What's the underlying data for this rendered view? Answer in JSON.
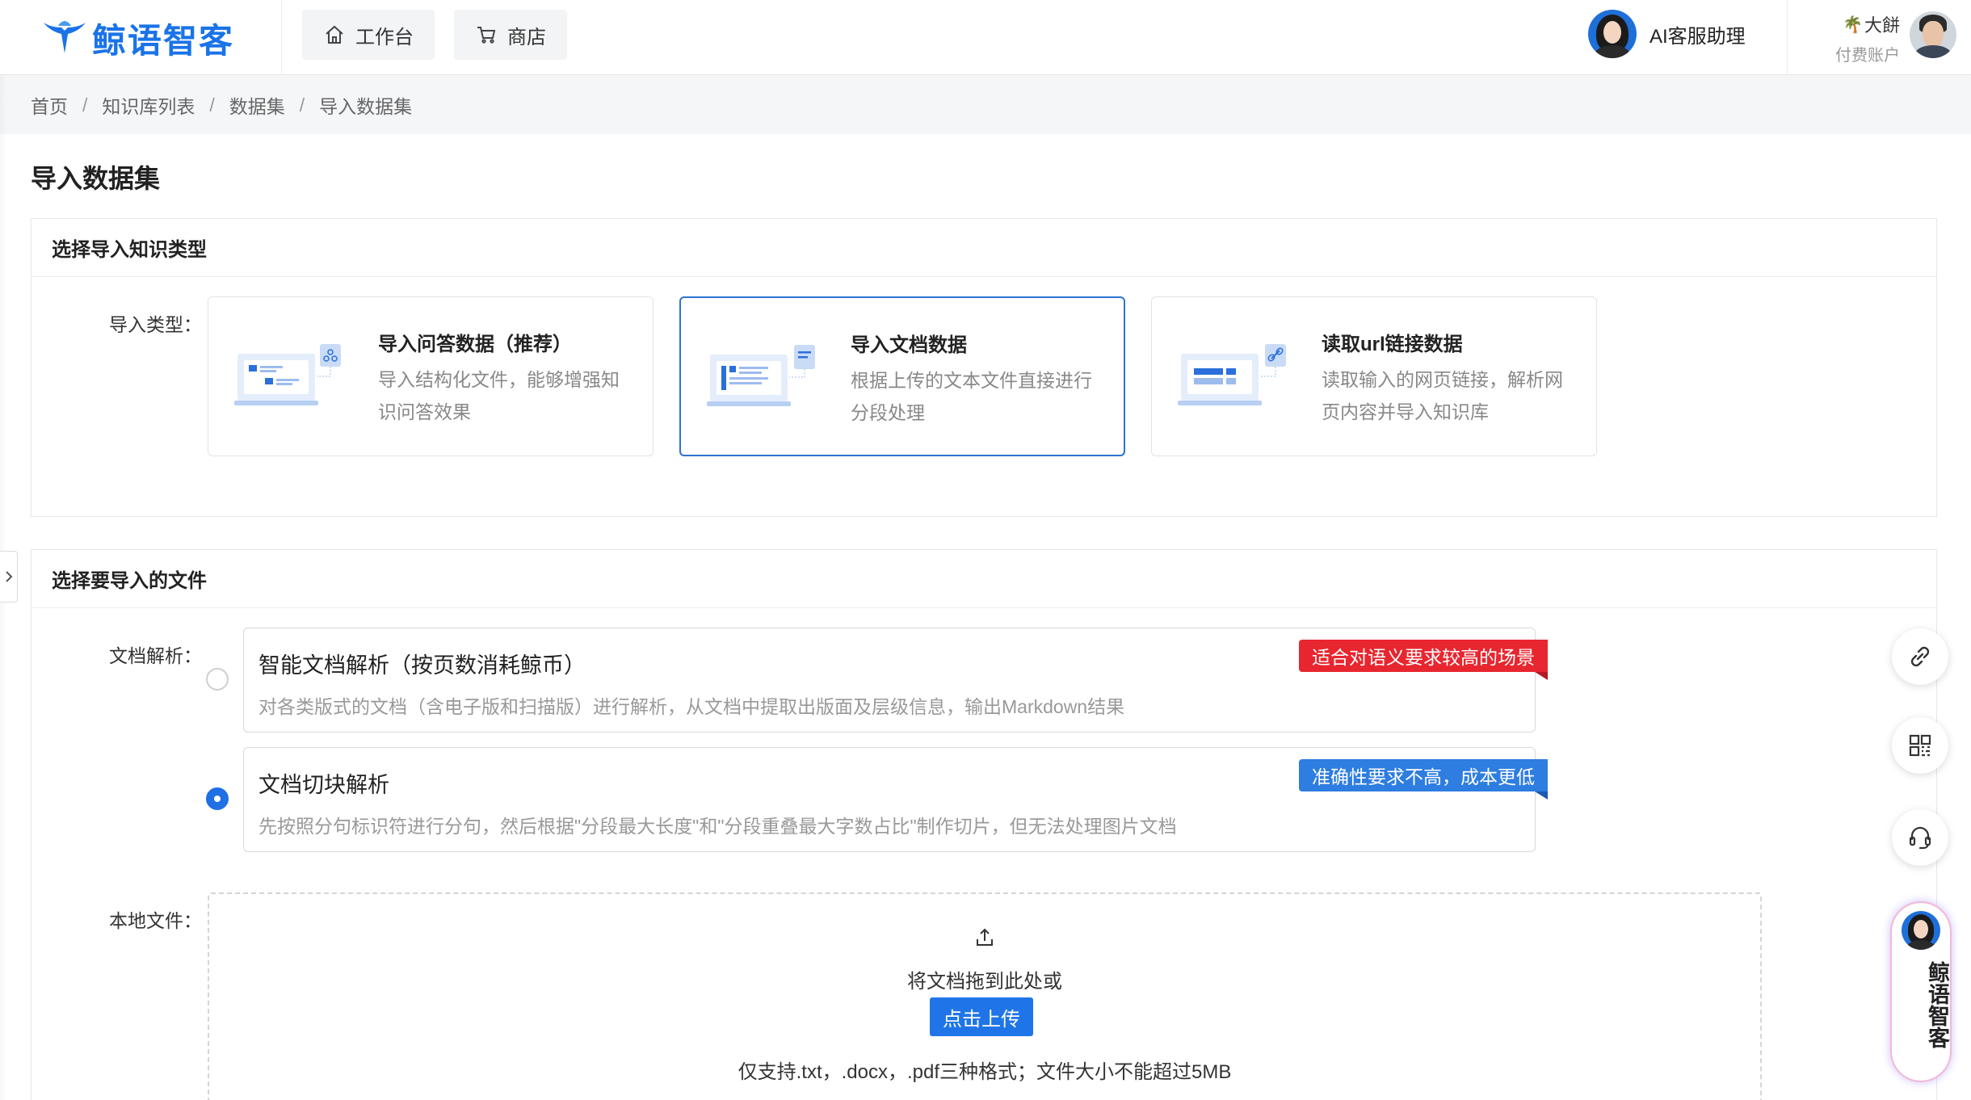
{
  "app": {
    "logo_text": "鲸语智客",
    "brand_color": "#1a73e8"
  },
  "header": {
    "nav": [
      {
        "label": "工作台",
        "icon": "home-icon"
      },
      {
        "label": "商店",
        "icon": "cart-icon"
      }
    ],
    "assistant_label": "AI客服助理",
    "user": {
      "name": "大餅",
      "plan": "付费账户"
    }
  },
  "breadcrumb": [
    "首页",
    "知识库列表",
    "数据集",
    "导入数据集"
  ],
  "breadcrumb_separator": "/",
  "page_title": "导入数据集",
  "import_type_section": {
    "title": "选择导入知识类型",
    "label": "导入类型：",
    "selected_index": 1,
    "cards": [
      {
        "title": "导入问答数据（推荐）",
        "desc": "导入结构化文件，能够增强知识问答效果",
        "icon": "qa-import-illustration"
      },
      {
        "title": "导入文档数据",
        "desc": "根据上传的文本文件直接进行分段处理",
        "icon": "document-import-illustration"
      },
      {
        "title": "读取url链接数据",
        "desc": "读取输入的网页链接，解析网页内容并导入知识库",
        "icon": "url-import-illustration"
      }
    ]
  },
  "file_section": {
    "title": "选择要导入的文件",
    "parse_label": "文档解析：",
    "parse_options": [
      {
        "title": "智能文档解析（按页数消耗鲸币）",
        "desc": "对各类版式的文档（含电子版和扫描版）进行解析，从文档中提取出版面及层级信息，输出Markdown结果",
        "tag": "适合对语义要求较高的场景",
        "tag_color": "#e8262f",
        "checked": false
      },
      {
        "title": "文档切块解析",
        "desc": "先按照分句标识符进行分句，然后根据\"分段最大长度\"和\"分段重叠最大字数占比\"制作切片，但无法处理图片文档",
        "tag": "准确性要求不高，成本更低",
        "tag_color": "#2e7de0",
        "checked": true
      }
    ],
    "local_file_label": "本地文件：",
    "upload": {
      "hint": "将文档拖到此处或",
      "button": "点击上传",
      "formats": "仅支持.txt，.docx，.pdf三种格式；文件大小不能超过5MB"
    }
  },
  "side_widget": {
    "brand_chars": [
      "鲸",
      "语",
      "智",
      "客"
    ],
    "buttons": [
      "link-icon",
      "qrcode-icon",
      "headset-icon"
    ]
  }
}
